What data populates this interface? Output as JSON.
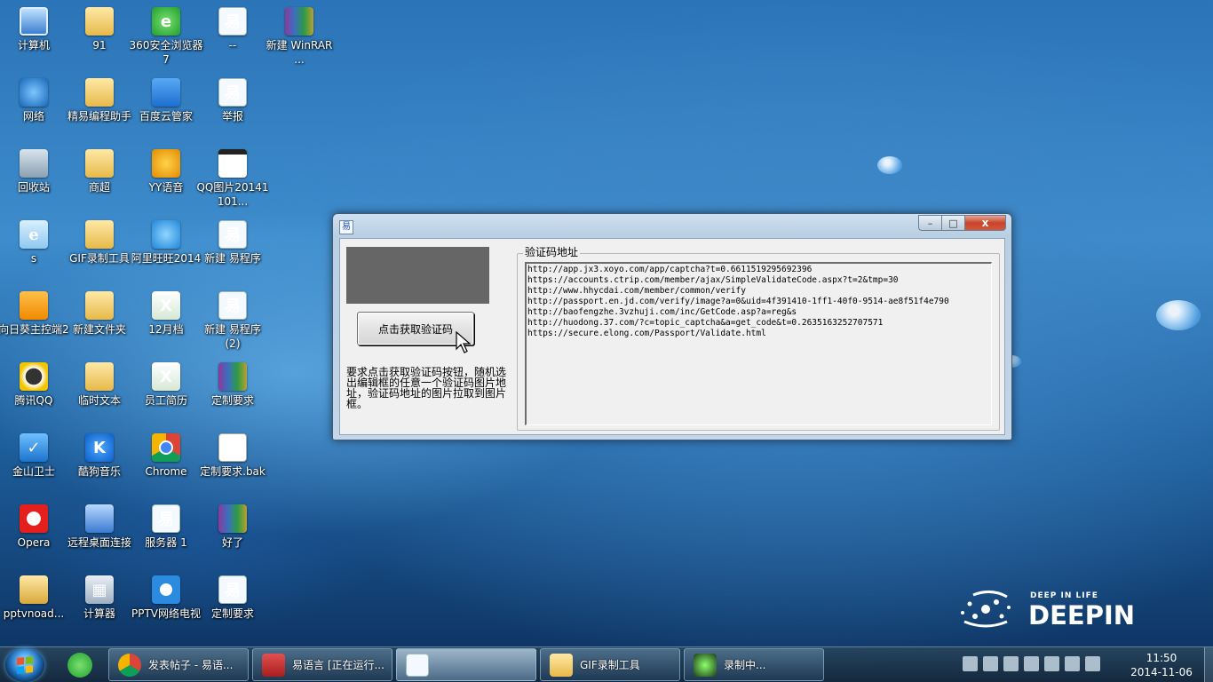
{
  "desktop": {
    "icons": [
      {
        "label": "计算机",
        "icon": "computer-icon"
      },
      {
        "label": "91",
        "icon": "folder-icon"
      },
      {
        "label": "360安全浏览器7",
        "icon": "360-browser-icon"
      },
      {
        "label": "--",
        "icon": "easy-language-icon"
      },
      {
        "label": "新建 WinRAR ...",
        "icon": "winrar-icon"
      },
      {
        "label": "网络",
        "icon": "network-icon"
      },
      {
        "label": "精易编程助手",
        "icon": "folder-icon"
      },
      {
        "label": "百度云管家",
        "icon": "baidu-cloud-icon"
      },
      {
        "label": "举报",
        "icon": "easy-language-icon"
      },
      {
        "label": "回收站",
        "icon": "recycle-bin-icon"
      },
      {
        "label": "商超",
        "icon": "folder-icon"
      },
      {
        "label": "YY语音",
        "icon": "yy-icon"
      },
      {
        "label": "QQ图片20141101...",
        "icon": "image-file-icon"
      },
      {
        "label": "s",
        "icon": "ie-icon"
      },
      {
        "label": "GIF录制工具",
        "icon": "folder-icon"
      },
      {
        "label": "阿里旺旺2014",
        "icon": "aliwangwang-icon"
      },
      {
        "label": "新建 易程序",
        "icon": "easy-language-icon"
      },
      {
        "label": "向日葵主控端2",
        "icon": "sunflower-icon"
      },
      {
        "label": "新建文件夹",
        "icon": "folder-icon"
      },
      {
        "label": "12月档",
        "icon": "excel-icon"
      },
      {
        "label": "新建 易程序 (2)",
        "icon": "easy-language-icon"
      },
      {
        "label": "腾讯QQ",
        "icon": "qq-icon"
      },
      {
        "label": "临时文本",
        "icon": "folder-icon"
      },
      {
        "label": "员工简历",
        "icon": "excel-icon"
      },
      {
        "label": "定制要求",
        "icon": "winrar-icon"
      },
      {
        "label": "金山卫士",
        "icon": "shield-icon"
      },
      {
        "label": "酷狗音乐",
        "icon": "kugou-icon"
      },
      {
        "label": "Chrome",
        "icon": "chrome-icon"
      },
      {
        "label": "定制要求.bak",
        "icon": "file-icon"
      },
      {
        "label": "Opera",
        "icon": "opera-icon"
      },
      {
        "label": "远程桌面连接",
        "icon": "remote-desktop-icon"
      },
      {
        "label": "服务器 1",
        "icon": "easy-language-icon"
      },
      {
        "label": "好了",
        "icon": "winrar-icon"
      },
      {
        "label": "pptvnoad...",
        "icon": "folder-icon"
      },
      {
        "label": "计算器",
        "icon": "calculator-icon"
      },
      {
        "label": "PPTV网络电视",
        "icon": "pptv-icon"
      },
      {
        "label": "定制要求",
        "icon": "easy-language-icon"
      }
    ]
  },
  "wallpaper": {
    "brand_tagline": "DEEP IN LIFE",
    "brand_name": "DEEPIN"
  },
  "window": {
    "get_button_label": "点击获取验证码",
    "instructions": "要求点击获取验证码按钮，随机选出编辑框的任意一个验证码图片地址，验证码地址的图片拉取到图片框。",
    "group_label": "验证码地址",
    "urls": [
      "http://app.jx3.xoyo.com/app/captcha?t=0.6611519295692396",
      "https://accounts.ctrip.com/member/ajax/SimpleValidateCode.aspx?t=2&tmp=30",
      "http://www.hhycdai.com/member/common/verify",
      "http://passport.en.jd.com/verify/image?a=0&uid=4f391410-1ff1-40f0-9514-ae8f51f4e790",
      "http://baofengzhe.3vzhuji.com/inc/GetCode.asp?a=reg&s",
      "http://huodong.37.com/?c=topic_captcha&a=get_code&t=0.2635163252707571",
      "https://secure.elong.com/Passport/Validate.html"
    ],
    "controls": {
      "minimize": "–",
      "maximize": "□",
      "close": "x"
    }
  },
  "taskbar": {
    "tasks": [
      {
        "label": "发表帖子 - 易语...",
        "icon": "chrome-icon"
      },
      {
        "label": "易语言 [正在运行...",
        "icon": "easy-language-icon"
      },
      {
        "label": "",
        "icon": "easy-language-icon"
      },
      {
        "label": "GIF录制工具",
        "icon": "folder-icon"
      },
      {
        "label": "录制中...",
        "icon": "recorder-icon"
      }
    ],
    "clock_time": "11:50",
    "clock_date": "2014-11-06"
  }
}
